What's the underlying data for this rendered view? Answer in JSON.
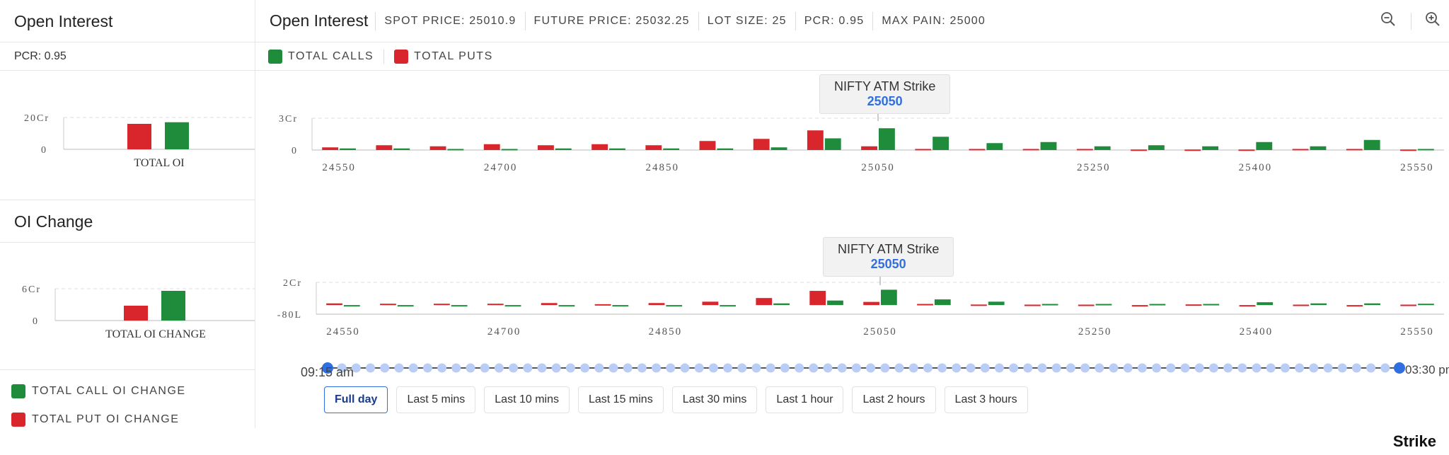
{
  "sidebar": {
    "title": "Open Interest",
    "pcr": "PCR: 0.95",
    "oi_change_title": "OI Change",
    "legend": [
      {
        "label": "TOTAL CALL OI CHANGE",
        "color": "#1e8c3a"
      },
      {
        "label": "TOTAL PUT OI CHANGE",
        "color": "#d8262c"
      }
    ]
  },
  "header": {
    "title": "Open Interest",
    "spot_price": "SPOT PRICE: 25010.9",
    "future_price": "FUTURE PRICE: 25032.25",
    "lot_size": "LOT SIZE: 25",
    "pcr": "PCR: 0.95",
    "max_pain": "MAX PAIN: 25000",
    "zoom_out_icon": "zoom-out-icon",
    "zoom_in_icon": "zoom-in-icon"
  },
  "legend": {
    "calls": "TOTAL CALLS",
    "puts": "TOTAL PUTS"
  },
  "tooltip": {
    "title": "NIFTY ATM Strike",
    "value": "25050"
  },
  "timeline": {
    "start": "09:15 am",
    "end": "03:30 pm",
    "buttons": [
      "Full day",
      "Last 5 mins",
      "Last 10 mins",
      "Last 15 mins",
      "Last 30 mins",
      "Last 1 hour",
      "Last 2 hours",
      "Last 3 hours"
    ],
    "active": "Full day"
  },
  "logo": "Strike",
  "colors": {
    "calls": "#1e8c3a",
    "puts": "#d8262c",
    "accent": "#2f6fe0"
  },
  "chart_data": [
    {
      "type": "bar",
      "xlabel": "",
      "categories": [
        "TOTAL OI"
      ],
      "series": [
        {
          "name": "TOTAL PUTS",
          "values": [
            16
          ]
        },
        {
          "name": "TOTAL CALLS",
          "values": [
            17
          ]
        }
      ],
      "yticks": [
        "20Cr",
        "0"
      ],
      "ylim": [
        0,
        20
      ]
    },
    {
      "type": "bar",
      "xlabel": "",
      "categories": [
        "TOTAL OI CHANGE"
      ],
      "series": [
        {
          "name": "TOTAL PUT OI CHANGE",
          "values": [
            2.8
          ]
        },
        {
          "name": "TOTAL CALL OI CHANGE",
          "values": [
            5.6
          ]
        }
      ],
      "yticks": [
        "6Cr",
        "0"
      ],
      "ylim": [
        0,
        6
      ]
    },
    {
      "type": "bar",
      "strikes": [
        24550,
        24600,
        24650,
        24700,
        24750,
        24800,
        24850,
        24900,
        24950,
        25000,
        25050,
        25100,
        25150,
        25200,
        25250,
        25300,
        25350,
        25400,
        25450,
        25500,
        25550
      ],
      "xticks": [
        "24550",
        "24700",
        "24850",
        "25050",
        "25250",
        "25400",
        "25550"
      ],
      "yticks": [
        "3Cr",
        "0"
      ],
      "ylim": [
        0,
        3
      ],
      "series": [
        {
          "name": "TOTAL PUTS",
          "values": [
            0.25,
            0.45,
            0.35,
            0.55,
            0.45,
            0.55,
            0.45,
            0.85,
            1.05,
            1.85,
            0.35,
            0.1,
            0.1,
            0.1,
            0.1,
            0.05,
            0.05,
            0.05,
            0.1,
            0.1,
            0.05
          ]
        },
        {
          "name": "TOTAL CALLS",
          "values": [
            0.15,
            0.15,
            0.1,
            0.1,
            0.15,
            0.15,
            0.15,
            0.15,
            0.25,
            1.1,
            2.05,
            1.25,
            0.65,
            0.75,
            0.35,
            0.45,
            0.35,
            0.75,
            0.35,
            0.95,
            0.1
          ]
        }
      ]
    },
    {
      "type": "bar",
      "strikes": [
        24550,
        24600,
        24650,
        24700,
        24750,
        24800,
        24850,
        24900,
        24950,
        25000,
        25050,
        25100,
        25150,
        25200,
        25250,
        25300,
        25350,
        25400,
        25450,
        25500,
        25550
      ],
      "xticks": [
        "24550",
        "24700",
        "24850",
        "25050",
        "25250",
        "25400",
        "25550"
      ],
      "yticks": [
        "2Cr",
        "-80L"
      ],
      "ylim": [
        -0.8,
        2
      ],
      "series": [
        {
          "name": "TOTAL PUT OI CHANGE",
          "values": [
            0.15,
            0.12,
            0.12,
            0.12,
            0.18,
            0.08,
            0.18,
            0.3,
            0.62,
            1.25,
            0.28,
            0.1,
            0.05,
            0.04,
            0.04,
            -0.1,
            0.06,
            -0.12,
            0.04,
            -0.1,
            0.04
          ]
        },
        {
          "name": "TOTAL CALL OI CHANGE",
          "values": [
            -0.12,
            -0.08,
            -0.08,
            -0.08,
            -0.1,
            -0.08,
            -0.08,
            -0.12,
            0.15,
            0.4,
            1.35,
            0.5,
            0.3,
            0.1,
            0.1,
            0.1,
            0.1,
            0.25,
            0.15,
            0.15,
            0.12
          ]
        }
      ]
    }
  ]
}
